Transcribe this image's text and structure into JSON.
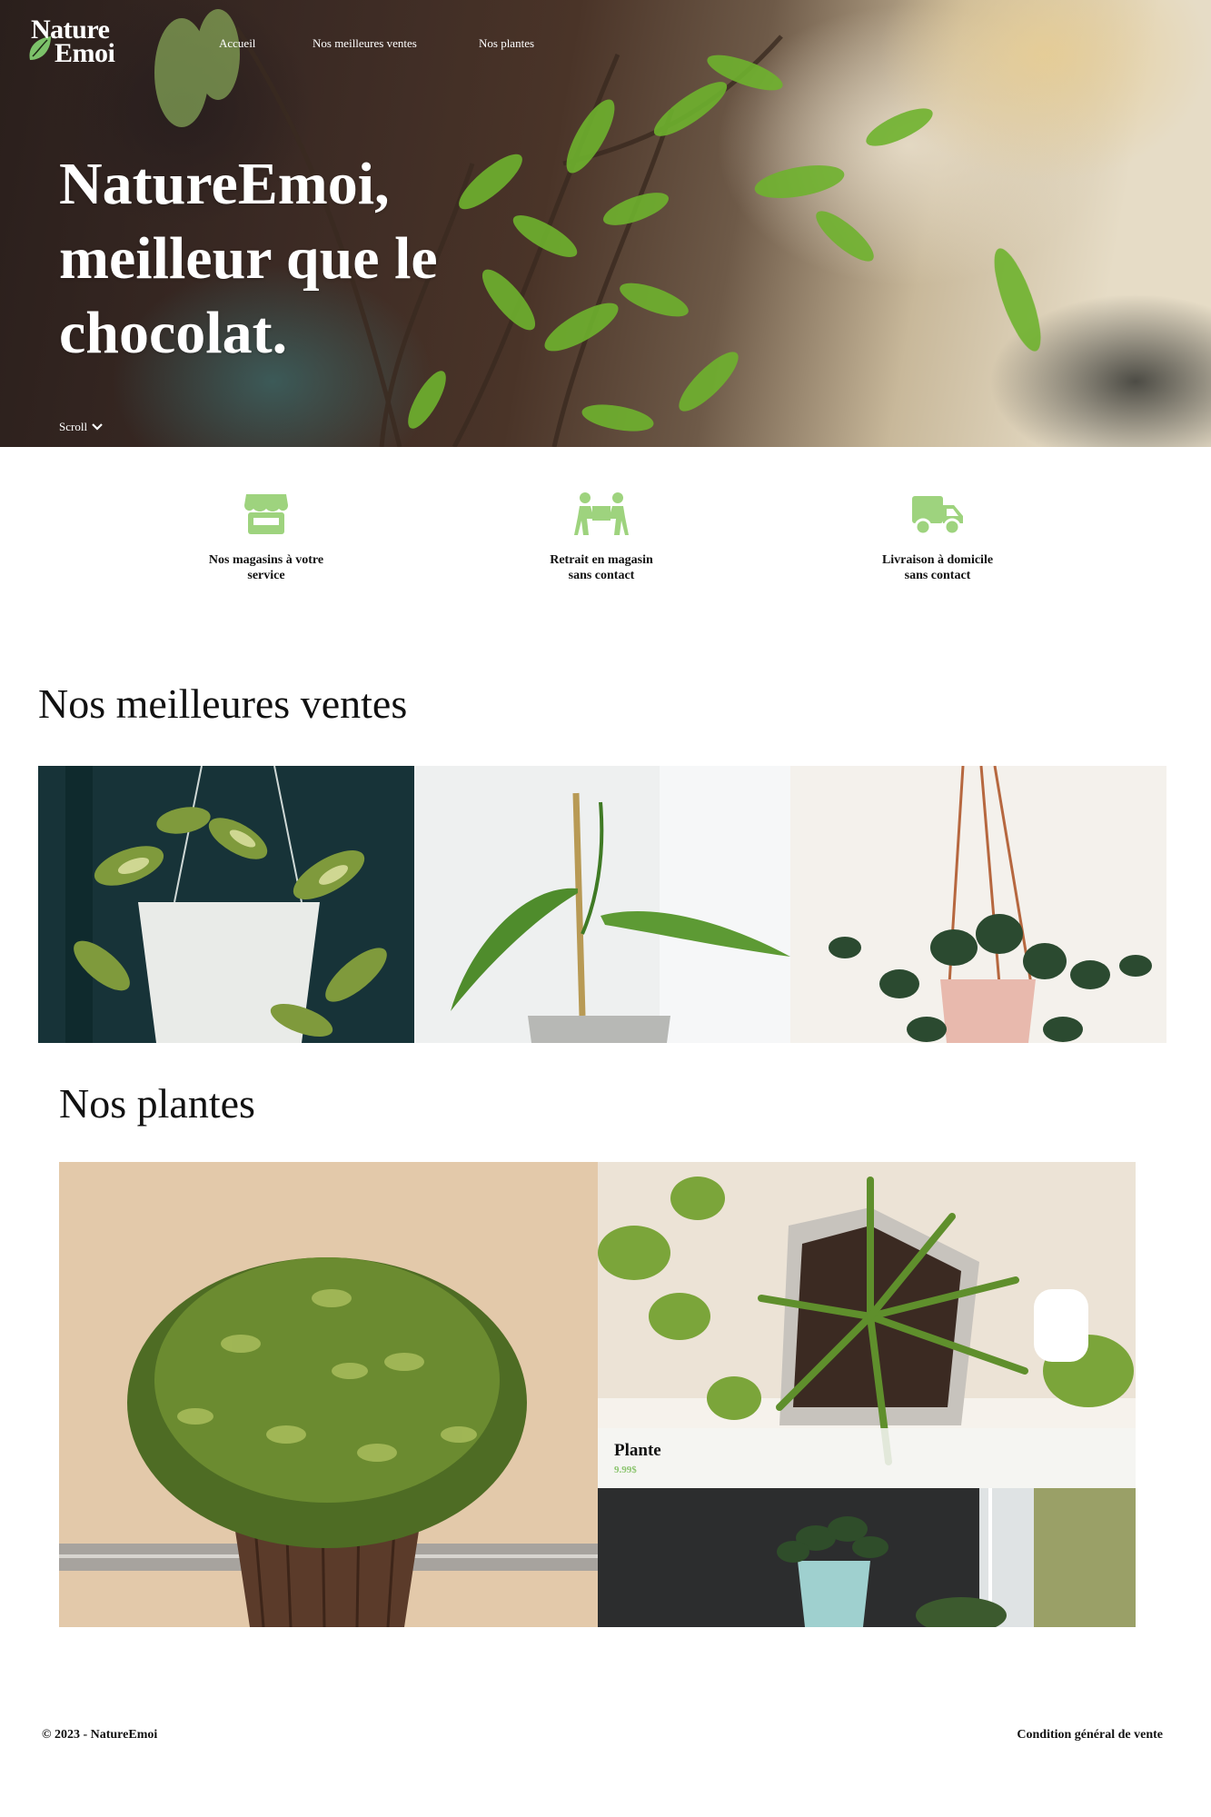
{
  "brand": {
    "line1": "Nature",
    "line2": "Emoi",
    "accent": "#7cc26a"
  },
  "nav": {
    "items": [
      "Accueil",
      "Nos meilleures ventes",
      "Nos plantes"
    ]
  },
  "hero": {
    "title": "NatureEmoi, meilleur que le chocolat.",
    "scroll_label": "Scroll"
  },
  "features": [
    {
      "icon": "store-icon",
      "label": "Nos magasins à votre\nservice"
    },
    {
      "icon": "movers-icon",
      "label": "Retrait en magasin\nsans contact"
    },
    {
      "icon": "truck-icon",
      "label": "Livraison à domicile\nsans contact"
    }
  ],
  "best_sellers": {
    "title": "Nos meilleures ventes"
  },
  "plants": {
    "title": "Nos plantes",
    "featured_card": {
      "name": "Plante",
      "price": "9.99$"
    }
  },
  "footer": {
    "copyright": "© 2023 - NatureEmoi",
    "terms_link": "Condition général de vente"
  },
  "colors": {
    "icon_green": "#9ed37e",
    "price_green": "#8cc56f"
  }
}
